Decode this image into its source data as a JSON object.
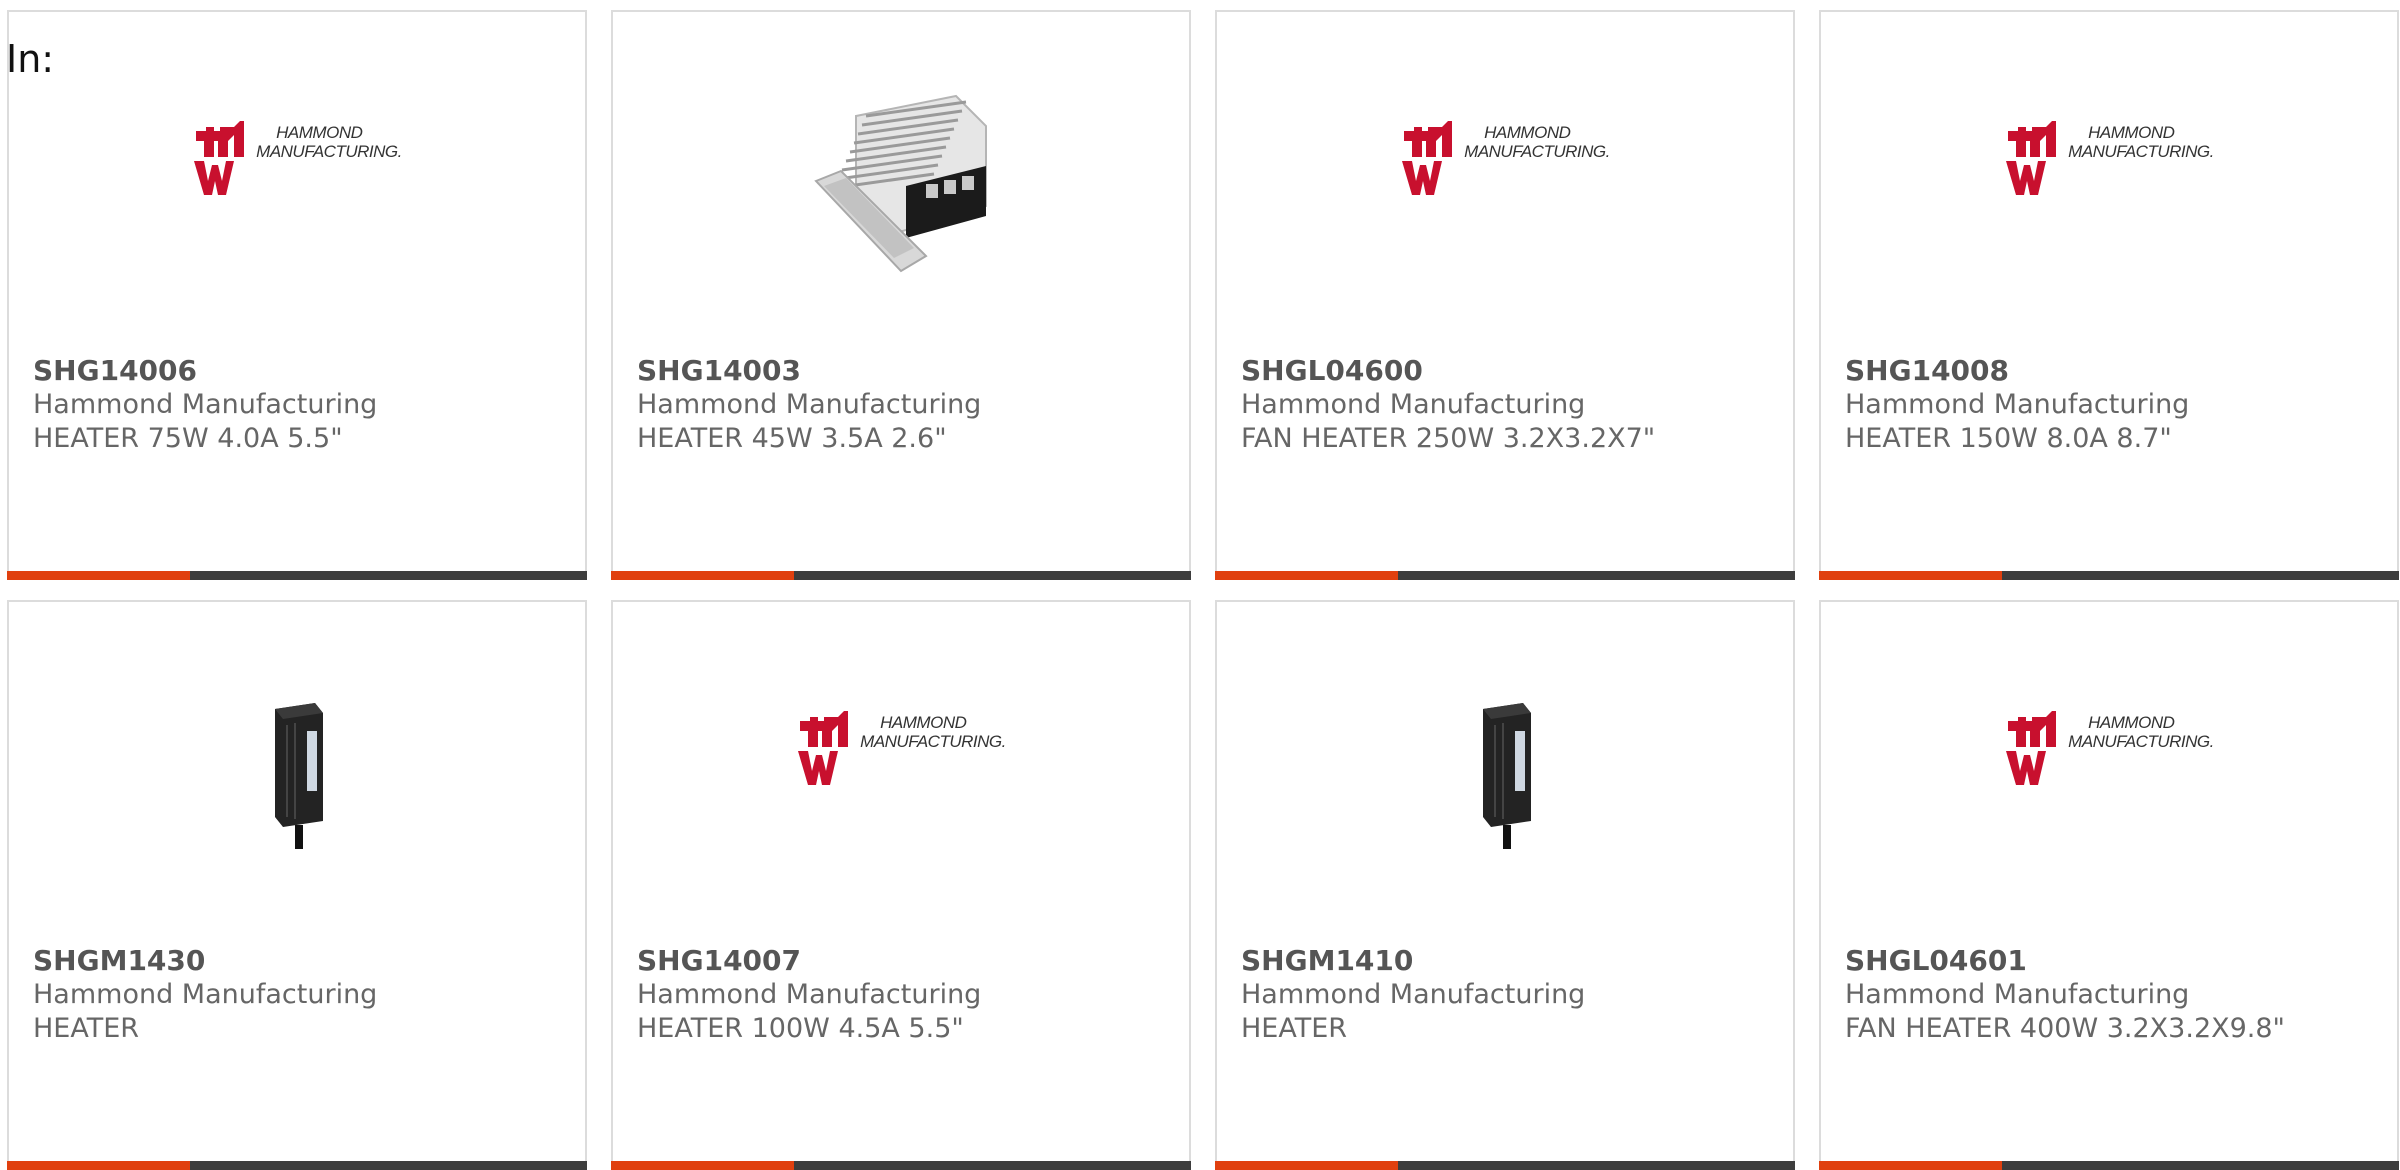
{
  "page": {
    "in_label": "In:"
  },
  "logo": {
    "line1": "HAMMOND",
    "line2": "MANUFACTURING.",
    "brand_red": "#c8102e"
  },
  "colors": {
    "accent": "#e0400f",
    "bar_dark": "#3d3d3d",
    "text": "#555555",
    "border": "#dcdcdc"
  },
  "products": [
    {
      "part_number": "SHG14006",
      "manufacturer": "Hammond Manufacturing",
      "description": "HEATER 75W 4.0A 5.5\"",
      "image": "hammond-logo"
    },
    {
      "part_number": "SHG14003",
      "manufacturer": "Hammond Manufacturing",
      "description": "HEATER 45W 3.5A 2.6\"",
      "image": "finned-heater-din-rail"
    },
    {
      "part_number": "SHGL04600",
      "manufacturer": "Hammond Manufacturing",
      "description": "FAN HEATER 250W 3.2X3.2X7\"",
      "image": "hammond-logo"
    },
    {
      "part_number": "SHG14008",
      "manufacturer": "Hammond Manufacturing",
      "description": "HEATER 150W 8.0A 8.7\"",
      "image": "hammond-logo"
    },
    {
      "part_number": "SHGM1430",
      "manufacturer": "Hammond Manufacturing",
      "description": "HEATER",
      "image": "compact-black-heater"
    },
    {
      "part_number": "SHG14007",
      "manufacturer": "Hammond Manufacturing",
      "description": "HEATER 100W 4.5A 5.5\"",
      "image": "hammond-logo"
    },
    {
      "part_number": "SHGM1410",
      "manufacturer": "Hammond Manufacturing",
      "description": "HEATER",
      "image": "compact-black-heater"
    },
    {
      "part_number": "SHGL04601",
      "manufacturer": "Hammond Manufacturing",
      "description": "FAN HEATER 400W 3.2X3.2X9.8\"",
      "image": "hammond-logo"
    }
  ]
}
